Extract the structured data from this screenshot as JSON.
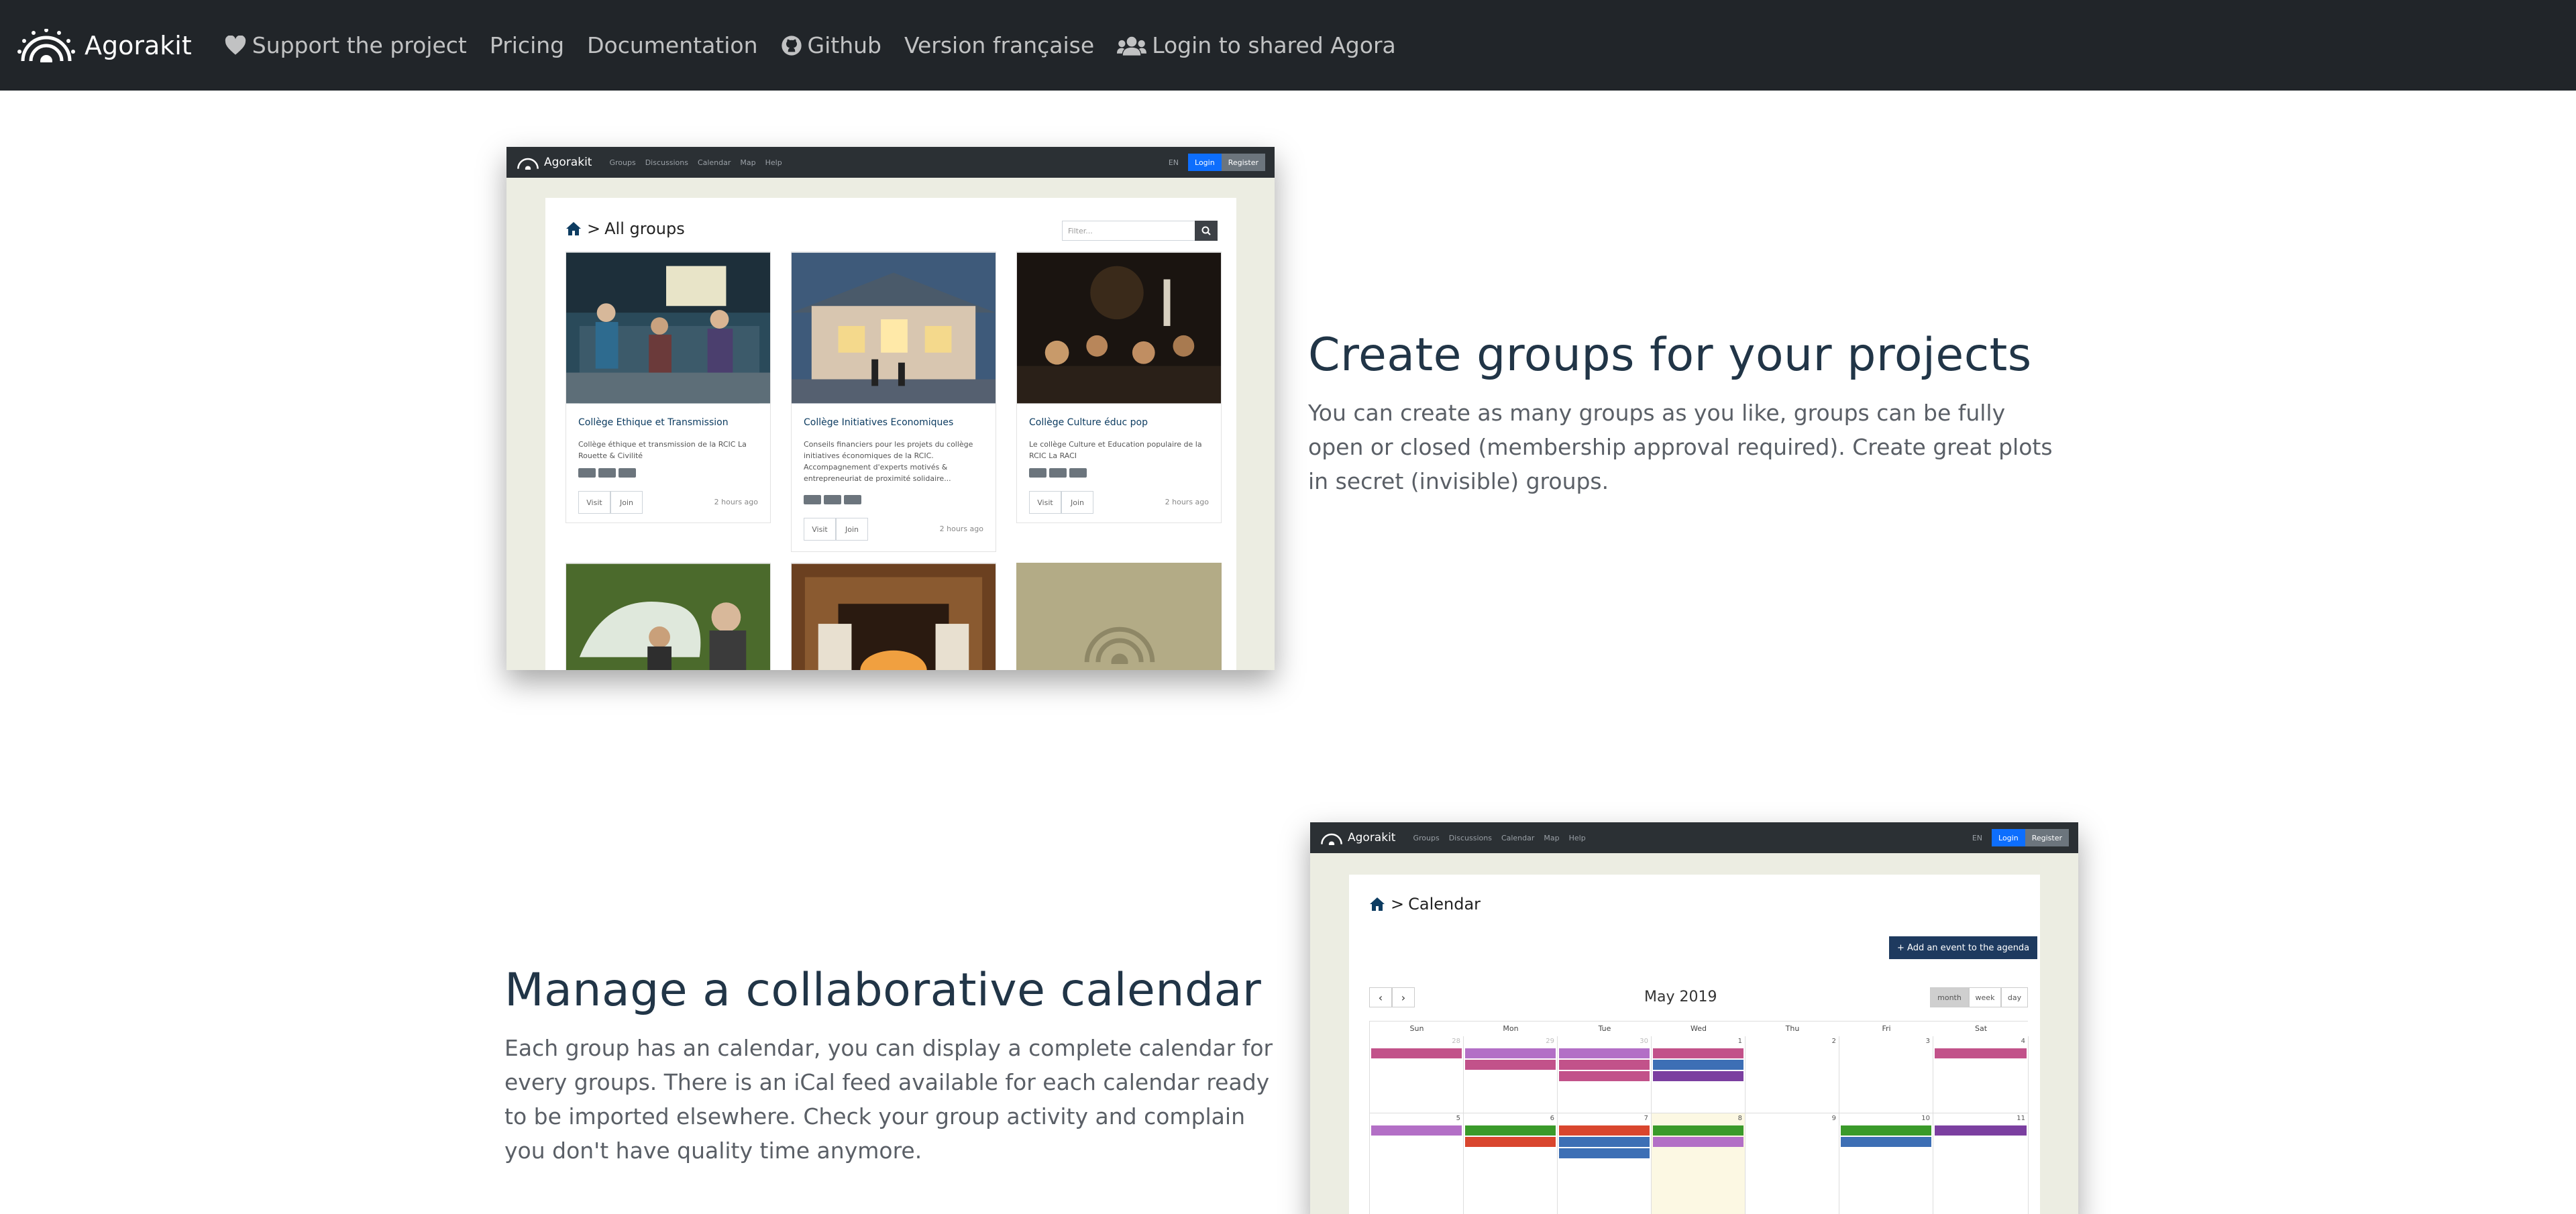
{
  "navbar": {
    "brand": "Agorakit",
    "links": [
      {
        "label": "Support the project",
        "icon": "heart-icon"
      },
      {
        "label": "Pricing"
      },
      {
        "label": "Documentation"
      },
      {
        "label": "Github",
        "icon": "github-icon"
      },
      {
        "label": "Version française"
      },
      {
        "label": "Login to shared Agora",
        "icon": "users-icon"
      }
    ]
  },
  "section_groups": {
    "title": "Create groups for your projects",
    "text": "You can create as many groups as you like, groups can be fully open or closed (membership approval required). Create great plots in secret (invisible) groups.",
    "screenshot": {
      "brand": "Agorakit",
      "nav": [
        "Groups",
        "Discussions",
        "Calendar",
        "Map",
        "Help"
      ],
      "lang": "EN",
      "login": "Login",
      "register": "Register",
      "breadcrumb": "All groups",
      "filter_placeholder": "Filter...",
      "cards": [
        {
          "title": "Collège Ethique et Transmission",
          "text": "Collège éthique et transmission de la RCIC La Rouette & Civilité",
          "btn_visit": "Visit",
          "btn_join": "Join",
          "time": "2 hours ago"
        },
        {
          "title": "Collège Initiatives Economiques",
          "text": "Conseils financiers pour les projets du collège initiatives économiques de la RCIC. Accompagnement d'experts motivés & entrepreneuriat de proximité solidaire...",
          "btn_visit": "Visit",
          "btn_join": "Join",
          "time": "2 hours ago"
        },
        {
          "title": "Collège Culture éduc pop",
          "text": "Le collège Culture et Education populaire de la RCIC La RACI",
          "btn_visit": "Visit",
          "btn_join": "Join",
          "time": "2 hours ago"
        }
      ]
    }
  },
  "section_calendar": {
    "title": "Manage a collaborative calendar",
    "text": "Each group has an calendar, you can display a complete calendar for every groups. There is an iCal feed available for each calendar ready to be imported elsewhere. Check your group activity and complain you don't have quality time anymore.",
    "screenshot": {
      "brand": "Agorakit",
      "nav": [
        "Groups",
        "Discussions",
        "Calendar",
        "Map",
        "Help"
      ],
      "lang": "EN",
      "login": "Login",
      "register": "Register",
      "breadcrumb": "Calendar",
      "add_event": "+ Add an event to the agenda",
      "month": "May 2019",
      "views": [
        "month",
        "week",
        "day"
      ],
      "weekdays": [
        "Sun",
        "Mon",
        "Tue",
        "Wed",
        "Thu",
        "Fri",
        "Sat"
      ],
      "week1_days": [
        "28",
        "29",
        "30",
        "1",
        "2",
        "3",
        "4"
      ],
      "week2_days": [
        "5",
        "6",
        "7",
        "8",
        "9",
        "10",
        "11"
      ],
      "colors": {
        "pink": "#c2528a",
        "purple": "#7b3fa0",
        "green": "#3a9a2a",
        "red": "#d9462e",
        "blue": "#3d6fb5",
        "lavender": "#b36fc6"
      }
    }
  }
}
